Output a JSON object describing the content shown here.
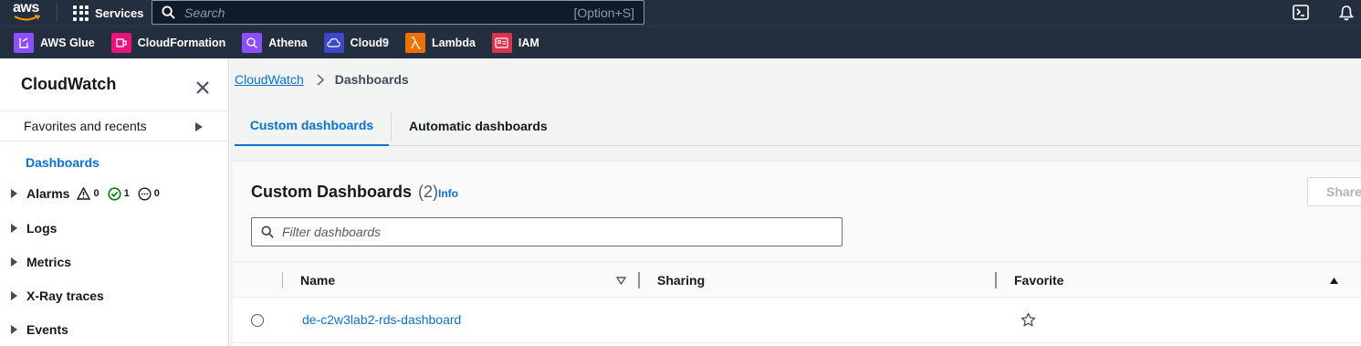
{
  "topnav": {
    "logo": "aws",
    "services_label": "Services",
    "search_placeholder": "Search",
    "search_shortcut": "[Option+S]"
  },
  "favorites": [
    {
      "label": "AWS Glue",
      "color": "#8c4fff"
    },
    {
      "label": "CloudFormation",
      "color": "#e7157b"
    },
    {
      "label": "Athena",
      "color": "#8c4fff"
    },
    {
      "label": "Cloud9",
      "color": "#3b48cc"
    },
    {
      "label": "Lambda",
      "color": "#ed7100"
    },
    {
      "label": "IAM",
      "color": "#dd344c"
    }
  ],
  "sidebar": {
    "title": "CloudWatch",
    "favorites_label": "Favorites and recents",
    "active_item": "Dashboards",
    "alarms": {
      "label": "Alarms",
      "in_alarm": "0",
      "ok": "1",
      "insufficient": "0"
    },
    "items": [
      {
        "label": "Logs"
      },
      {
        "label": "Metrics"
      },
      {
        "label": "X-Ray traces"
      },
      {
        "label": "Events"
      }
    ]
  },
  "breadcrumb": {
    "root": "CloudWatch",
    "current": "Dashboards"
  },
  "tabs": [
    {
      "label": "Custom dashboards",
      "active": true
    },
    {
      "label": "Automatic dashboards",
      "active": false
    }
  ],
  "panel": {
    "title": "Custom Dashboards",
    "count": "(2)",
    "info_label": "Info",
    "share_label": "Share",
    "filter_placeholder": "Filter dashboards",
    "columns": [
      "Name",
      "Sharing",
      "Favorite"
    ],
    "rows": [
      {
        "name": "de-c2w3lab2-rds-dashboard",
        "sharing": "",
        "favorite": false
      }
    ]
  },
  "colors": {
    "nav_bg": "#232f3e",
    "link": "#0972d3",
    "ok_green": "#037f0c"
  }
}
